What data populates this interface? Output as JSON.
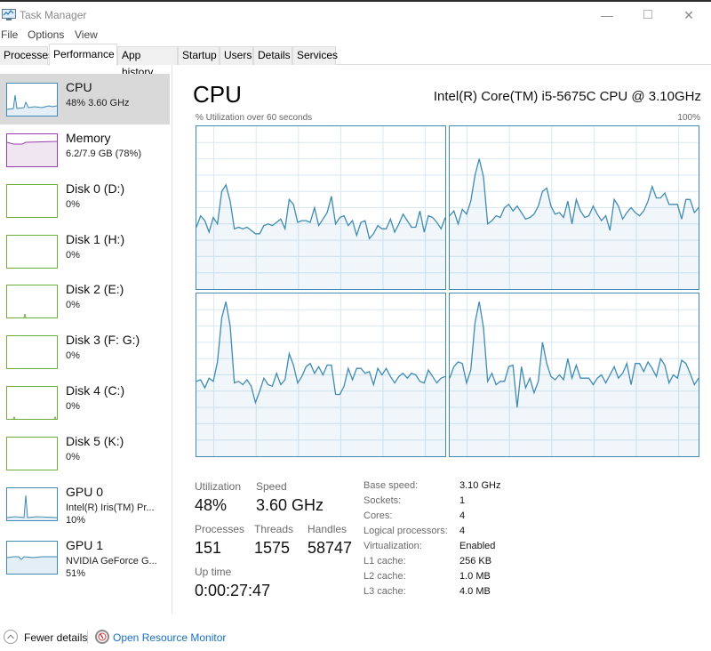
{
  "window": {
    "title": "Task Manager",
    "controls": {
      "minimize": "—",
      "maximize": "□",
      "close": "✕"
    }
  },
  "menu": [
    "File",
    "Options",
    "View"
  ],
  "tabs": [
    {
      "label": "Processes",
      "active": false
    },
    {
      "label": "Performance",
      "active": true
    },
    {
      "label": "App history",
      "active": false
    },
    {
      "label": "Startup",
      "active": false
    },
    {
      "label": "Users",
      "active": false
    },
    {
      "label": "Details",
      "active": false
    },
    {
      "label": "Services",
      "active": false
    }
  ],
  "sidebar": {
    "items": [
      {
        "name": "CPU",
        "sub": "48%  3.60 GHz",
        "color": "#3f8bb4",
        "active": true
      },
      {
        "name": "Memory",
        "sub": "6.2/7.9 GB (78%)",
        "color": "#9c3dac",
        "active": false
      },
      {
        "name": "Disk 0 (D:)",
        "sub": "0%",
        "color": "#6fae3c",
        "active": false
      },
      {
        "name": "Disk 1 (H:)",
        "sub": "0%",
        "color": "#6fae3c",
        "active": false
      },
      {
        "name": "Disk 2 (E:)",
        "sub": "0%",
        "color": "#6fae3c",
        "active": false
      },
      {
        "name": "Disk 3 (F: G:)",
        "sub": "0%",
        "color": "#6fae3c",
        "active": false
      },
      {
        "name": "Disk 4 (C:)",
        "sub": "0%",
        "color": "#6fae3c",
        "active": false
      },
      {
        "name": "Disk 5 (K:)",
        "sub": "0%",
        "color": "#6fae3c",
        "active": false
      },
      {
        "name": "GPU 0",
        "sub": "Intel(R) Iris(TM) Pr...",
        "sub2": "10%",
        "color": "#3f8bb4",
        "active": false
      },
      {
        "name": "GPU 1",
        "sub": "NVIDIA GeForce G...",
        "sub2": "51%",
        "color": "#3f8bb4",
        "active": false
      }
    ]
  },
  "main": {
    "title": "CPU",
    "model": "Intel(R) Core(TM) i5-5675C CPU @ 3.10GHz",
    "graph_label": "% Utilization over 60 seconds",
    "graph_max": "100%",
    "accent": "#3f8bb4",
    "stats": {
      "utilization": {
        "label": "Utilization",
        "value": "48%"
      },
      "speed": {
        "label": "Speed",
        "value": "3.60 GHz"
      },
      "processes": {
        "label": "Processes",
        "value": "151"
      },
      "threads": {
        "label": "Threads",
        "value": "1575"
      },
      "handles": {
        "label": "Handles",
        "value": "58747"
      },
      "uptime": {
        "label": "Up time",
        "value": "0:00:27:47"
      }
    },
    "details": [
      {
        "key": "Base speed:",
        "value": "3.10 GHz"
      },
      {
        "key": "Sockets:",
        "value": "1"
      },
      {
        "key": "Cores:",
        "value": "4"
      },
      {
        "key": "Logical processors:",
        "value": "4"
      },
      {
        "key": "Virtualization:",
        "value": "Enabled"
      },
      {
        "key": "L1 cache:",
        "value": "256 KB"
      },
      {
        "key": "L2 cache:",
        "value": "1.0 MB"
      },
      {
        "key": "L3 cache:",
        "value": "4.0 MB"
      }
    ]
  },
  "chart_data": {
    "type": "line",
    "title": "% Utilization over 60 seconds",
    "ylim": [
      0,
      100
    ],
    "ymax_label": "100%",
    "series": [
      {
        "name": "Logical processor 0",
        "values": [
          38,
          45,
          42,
          35,
          44,
          40,
          60,
          64,
          54,
          37,
          38,
          37,
          38,
          36,
          34,
          34,
          39,
          40,
          39,
          41,
          43,
          37,
          55,
          52,
          41,
          42,
          42,
          41,
          50,
          39,
          43,
          47,
          57,
          40,
          44,
          45,
          39,
          42,
          33,
          41,
          42,
          31,
          34,
          39,
          37,
          37,
          43,
          35,
          40,
          46,
          42,
          38,
          38,
          48,
          35,
          45,
          44,
          41,
          37,
          44
        ]
      },
      {
        "name": "Logical processor 1",
        "values": [
          45,
          48,
          40,
          49,
          46,
          54,
          70,
          80,
          69,
          40,
          42,
          45,
          44,
          50,
          52,
          48,
          51,
          47,
          43,
          44,
          46,
          51,
          60,
          62,
          51,
          46,
          47,
          44,
          54,
          40,
          55,
          48,
          44,
          45,
          51,
          46,
          42,
          45,
          36,
          55,
          51,
          43,
          47,
          50,
          47,
          45,
          48,
          54,
          63,
          56,
          56,
          59,
          52,
          52,
          52,
          43,
          55,
          55,
          47,
          50
        ]
      },
      {
        "name": "Logical processor 2",
        "values": [
          46,
          47,
          42,
          48,
          46,
          58,
          85,
          95,
          80,
          45,
          46,
          44,
          47,
          43,
          33,
          40,
          48,
          44,
          43,
          51,
          44,
          47,
          63,
          56,
          45,
          49,
          55,
          57,
          51,
          55,
          50,
          56,
          56,
          38,
          38,
          43,
          54,
          47,
          54,
          54,
          51,
          52,
          44,
          54,
          50,
          54,
          49,
          45,
          49,
          51,
          48,
          51,
          50,
          46,
          45,
          53,
          49,
          45,
          48,
          49
        ]
      },
      {
        "name": "Logical processor 3",
        "values": [
          48,
          55,
          58,
          57,
          45,
          53,
          82,
          95,
          79,
          46,
          51,
          44,
          46,
          46,
          55,
          56,
          30,
          55,
          42,
          48,
          39,
          46,
          70,
          57,
          49,
          47,
          50,
          47,
          60,
          48,
          56,
          48,
          48,
          48,
          44,
          48,
          50,
          45,
          50,
          55,
          48,
          51,
          57,
          44,
          57,
          57,
          52,
          58,
          54,
          49,
          60,
          56,
          45,
          50,
          48,
          59,
          57,
          51,
          44,
          48
        ]
      }
    ]
  },
  "footer": {
    "fewer_details": "Fewer details",
    "open_resource_monitor": "Open Resource Monitor"
  }
}
